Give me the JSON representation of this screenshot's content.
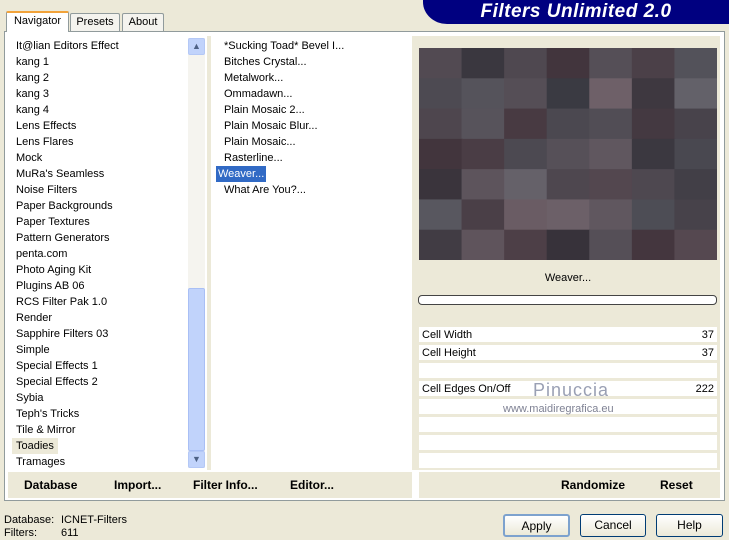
{
  "window": {
    "banner_title": "Filters Unlimited 2.0"
  },
  "tabs": [
    {
      "label": "Navigator",
      "active": true
    },
    {
      "label": "Presets"
    },
    {
      "label": "About"
    }
  ],
  "categories": {
    "items": [
      "It@lian Editors Effect",
      "kang 1",
      "kang 2",
      "kang 3",
      "kang 4",
      "Lens Effects",
      "Lens Flares",
      "Mock",
      "MuRa's Seamless",
      "Noise Filters",
      "Paper Backgrounds",
      "Paper Textures",
      "Pattern Generators",
      "penta.com",
      "Photo Aging Kit",
      "Plugins AB 06",
      "RCS Filter Pak 1.0",
      "Render",
      "Sapphire Filters 03",
      "Simple",
      "Special Effects 1",
      "Special Effects 2",
      "Sybia",
      "Teph's Tricks",
      "Tile & Mirror",
      "Toadies",
      "Tramages"
    ],
    "selected": "Toadies"
  },
  "filters": {
    "items": [
      "*Sucking Toad*  Bevel I...",
      "Bitches Crystal...",
      "Metalwork...",
      "Ommadawn...",
      "Plain Mosaic 2...",
      "Plain Mosaic Blur...",
      "Plain Mosaic...",
      "Rasterline...",
      "Weaver...",
      "What Are You?..."
    ],
    "selected": "Weaver..."
  },
  "filter_name": "Weaver...",
  "params": [
    {
      "label": "Cell Width",
      "value": "37"
    },
    {
      "label": "Cell Height",
      "value": "37"
    },
    {
      "label": "",
      "value": ""
    },
    {
      "label": "Cell Edges On/Off",
      "value": "222"
    },
    {
      "label": "",
      "value": ""
    },
    {
      "label": "",
      "value": ""
    },
    {
      "label": "",
      "value": ""
    },
    {
      "label": "",
      "value": ""
    }
  ],
  "watermark": {
    "name": "Pinuccia",
    "url": "www.maidiregrafica.eu"
  },
  "bottom_left": {
    "database": "Database",
    "import": "Import...",
    "filter_info": "Filter Info...",
    "editor": "Editor..."
  },
  "bottom_right": {
    "randomize": "Randomize",
    "reset": "Reset"
  },
  "status": {
    "database_label": "Database:",
    "database_value": "ICNET-Filters",
    "filters_label": "Filters:",
    "filters_value": "611"
  },
  "buttons": {
    "apply": "Apply",
    "cancel": "Cancel",
    "help": "Help"
  },
  "colors": {
    "selection": "#316ac5",
    "banner": "#000080"
  }
}
